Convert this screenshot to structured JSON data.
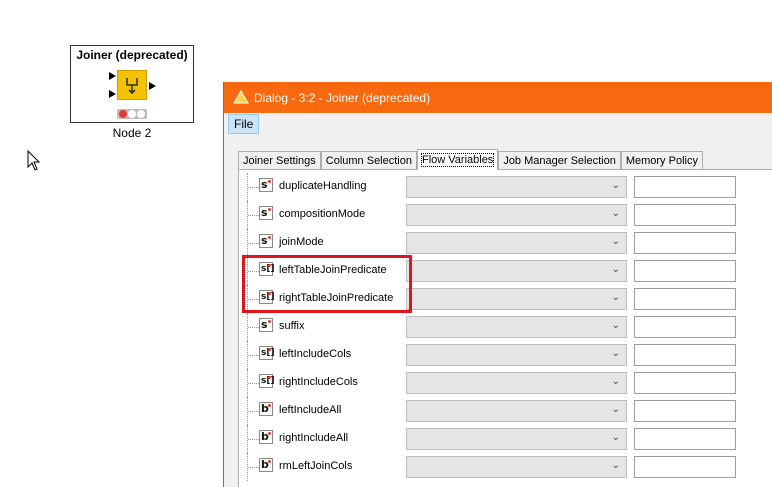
{
  "node": {
    "title": "Joiner (deprecated)",
    "label": "Node 2",
    "status_colors": [
      "#e53935",
      "#ffffff",
      "#ffffff"
    ]
  },
  "dialog": {
    "title": "Dialog - 3:2 - Joiner (deprecated)",
    "menu": [
      "File"
    ],
    "tabs": [
      {
        "label": "Joiner Settings",
        "active": false
      },
      {
        "label": "Column Selection",
        "active": false
      },
      {
        "label": "Flow Variables",
        "active": true
      },
      {
        "label": "Job Manager Selection",
        "active": false
      },
      {
        "label": "Memory Policy",
        "active": false
      }
    ],
    "variables": [
      {
        "name": "duplicateHandling",
        "type": "s",
        "selected": "",
        "value": ""
      },
      {
        "name": "compositionMode",
        "type": "s",
        "selected": "",
        "value": ""
      },
      {
        "name": "joinMode",
        "type": "s",
        "selected": "",
        "value": ""
      },
      {
        "name": "leftTableJoinPredicate",
        "type": "s[]",
        "selected": "",
        "value": ""
      },
      {
        "name": "rightTableJoinPredicate",
        "type": "s[]",
        "selected": "",
        "value": ""
      },
      {
        "name": "suffix",
        "type": "s",
        "selected": "",
        "value": ""
      },
      {
        "name": "leftIncludeCols",
        "type": "s[]",
        "selected": "",
        "value": ""
      },
      {
        "name": "rightIncludeCols",
        "type": "s[]",
        "selected": "",
        "value": ""
      },
      {
        "name": "leftIncludeAll",
        "type": "b",
        "selected": "",
        "value": ""
      },
      {
        "name": "rightIncludeAll",
        "type": "b",
        "selected": "",
        "value": ""
      },
      {
        "name": "rmLeftJoinCols",
        "type": "b",
        "selected": "",
        "value": ""
      }
    ]
  },
  "colors": {
    "titlebar": "#f6690f",
    "highlight": "#e0141b",
    "node_icon": "#f4c300"
  }
}
